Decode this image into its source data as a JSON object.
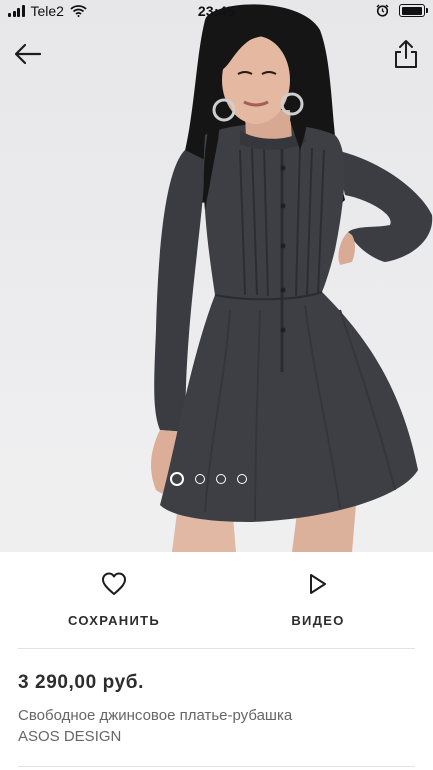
{
  "status_bar": {
    "carrier": "Tele2",
    "time": "23:45"
  },
  "gallery": {
    "image_count": 4,
    "active_index": 0
  },
  "actions": {
    "save_label": "СОХРАНИТЬ",
    "video_label": "ВИДЕО"
  },
  "product": {
    "price": "3 290,00 руб.",
    "name": "Свободное джинсовое платье-рубашка",
    "brand": "ASOS DESIGN"
  },
  "colors": {
    "text": "#2d2d2d",
    "secondary_text": "#666666",
    "divider": "#e3e3e3",
    "dress": "#3d3f45"
  },
  "icons": [
    "back-arrow-icon",
    "share-icon",
    "heart-icon",
    "play-icon",
    "wifi-icon",
    "alarm-icon",
    "battery-icon",
    "signal-icon"
  ]
}
